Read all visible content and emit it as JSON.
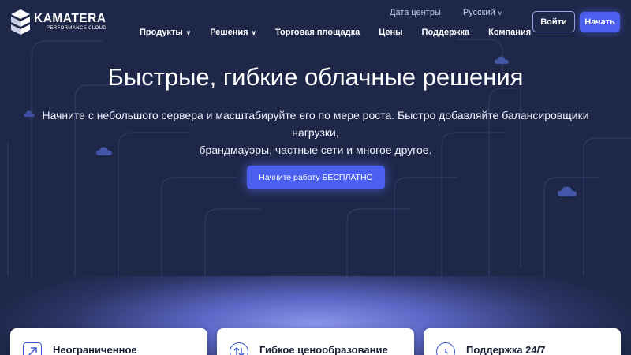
{
  "brand": {
    "name": "KAMATERA",
    "tagline": "PERFORMANCE CLOUD"
  },
  "top_links": [
    {
      "label": "Дата центры"
    },
    {
      "label": "Русский",
      "has_caret": true
    }
  ],
  "nav": [
    {
      "label": "Продукты",
      "has_caret": true
    },
    {
      "label": "Решения",
      "has_caret": true
    },
    {
      "label": "Торговая площадка"
    },
    {
      "label": "Цены"
    },
    {
      "label": "Поддержка"
    },
    {
      "label": "Компания"
    }
  ],
  "auth": {
    "login_label": "Войти",
    "start_label": "Начать"
  },
  "hero": {
    "title": "Быстрые, гибкие облачные решения",
    "subtitle_line1": "Начните с небольшого сервера и масштабируйте его по мере роста. Быстро добавляйте балансировщики нагрузки,",
    "subtitle_line2": "брандмауэры, частные сети и многое другое.",
    "cta_label": "Начните работу БЕСПЛАТНО"
  },
  "features": [
    {
      "title": "Неограниченное",
      "icon": "arrow-up-right-icon"
    },
    {
      "title": "Гибкое ценообразование",
      "icon": "arrows-up-down-icon"
    },
    {
      "title": "Поддержка 24/7",
      "icon": "clock-icon"
    }
  ],
  "colors": {
    "background": "#1e2748",
    "accent": "#4a5ff0",
    "text_light": "#ffffff",
    "card_text": "#1a1f36"
  }
}
